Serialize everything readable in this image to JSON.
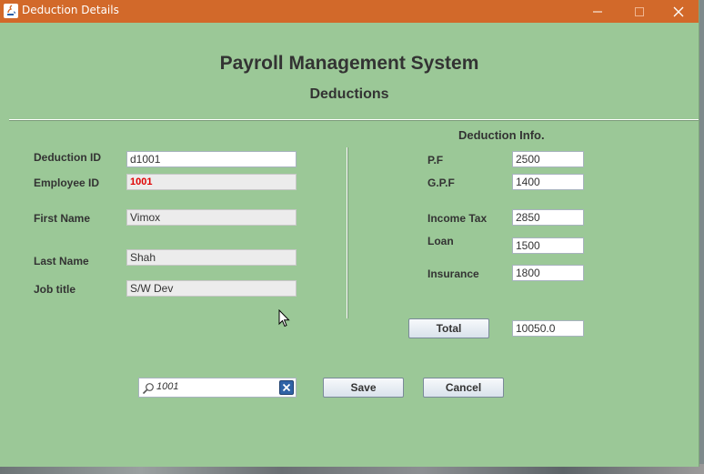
{
  "window": {
    "title": "Deduction Details"
  },
  "header": {
    "title": "Payroll Management System",
    "subtitle": "Deductions"
  },
  "employee": {
    "deduction_id_label": "Deduction  ID",
    "deduction_id": "d1001",
    "employee_id_label": "Employee ID",
    "employee_id": "1001",
    "first_name_label": "First Name",
    "first_name": "Vimox",
    "last_name_label": "Last Name",
    "last_name": "Shah",
    "job_title_label": "Job title",
    "job_title": "S/W Dev"
  },
  "deduction_info": {
    "heading": "Deduction Info.",
    "pf_label": "P.F",
    "pf": "2500",
    "gpf_label": "G.P.F",
    "gpf": "1400",
    "income_tax_label": "Income Tax",
    "income_tax": "2850",
    "loan_label": "Loan",
    "loan": "1500",
    "insurance_label": "Insurance",
    "insurance": "1800",
    "total_label": "Total",
    "total": "10050.0"
  },
  "search": {
    "value": "1001"
  },
  "actions": {
    "save_label": "Save",
    "cancel_label": "Cancel"
  },
  "colors": {
    "titlebar": "#d2692a",
    "panel": "#9bc897",
    "error_text": "#e00000"
  }
}
